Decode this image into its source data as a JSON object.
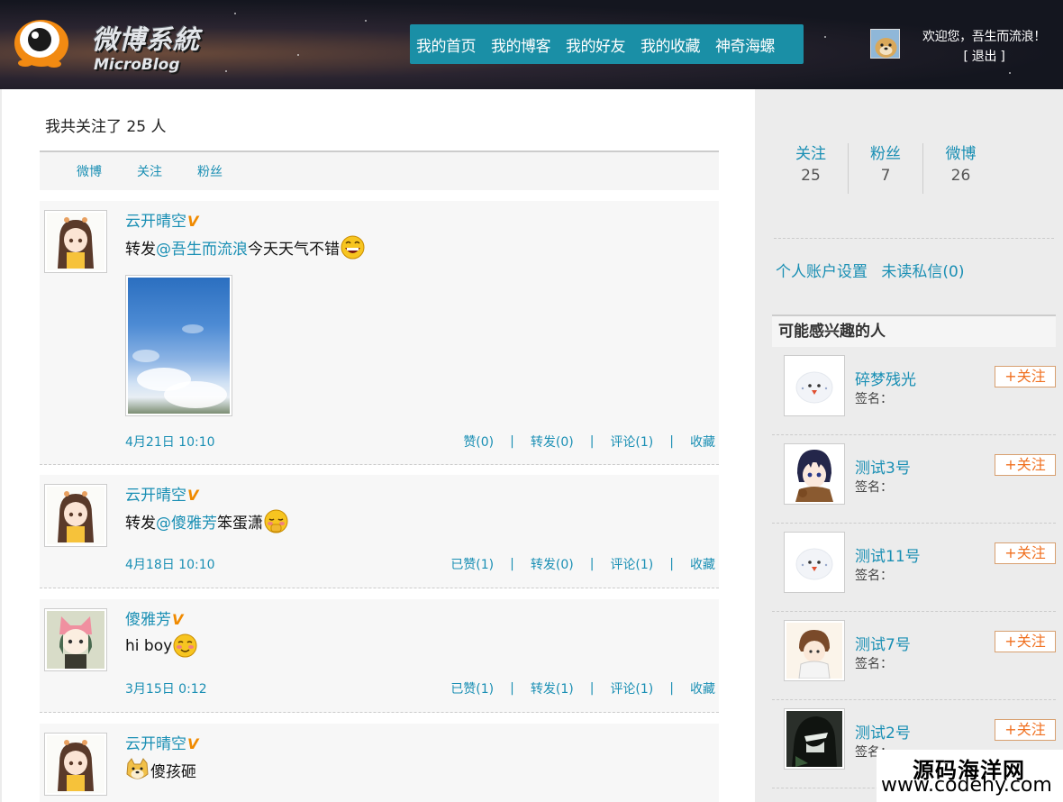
{
  "header": {
    "logo_title": "微博系統",
    "logo_subtitle": "MicroBlog",
    "nav": [
      "我的首页",
      "我的博客",
      "我的好友",
      "我的收藏",
      "神奇海螺"
    ],
    "welcome": "欢迎您，吾生而流浪！",
    "logout": "[ 退出 ]"
  },
  "main": {
    "follow_summary": "我共关注了 25 人",
    "subtabs": [
      "微博",
      "关注",
      "粉丝"
    ],
    "posts": [
      {
        "author": "云开晴空",
        "vip": "V",
        "prefix": "转发",
        "mention": "@吾生而流浪",
        "text": " 今天天气不错",
        "emoji": "grin-emoji",
        "time": "4月21日 10:10",
        "like": "赞(0)",
        "repost": "转发(0)",
        "comment": "评论(1)",
        "fav": "收藏"
      },
      {
        "author": "云开晴空",
        "vip": "V",
        "prefix": "转发",
        "mention": "@傻雅芳",
        "text": " 笨蛋潇",
        "emoji": "shy-emoji",
        "time": "4月18日 10:10",
        "like": "已赞(1)",
        "repost": "转发(0)",
        "comment": "评论(1)",
        "fav": "收藏"
      },
      {
        "author": "傻雅芳",
        "vip": "V",
        "prefix": "",
        "mention": "",
        "text": "hi boy",
        "emoji": "blush-emoji",
        "time": "3月15日 0:12",
        "like": "已赞(1)",
        "repost": "转发(1)",
        "comment": "评论(1)",
        "fav": "收藏"
      },
      {
        "author": "云开晴空",
        "vip": "V",
        "prefix": "",
        "mention": "",
        "text": "傻孩砸",
        "emoji": "doge-emoji"
      }
    ],
    "action_separator": "|"
  },
  "sidebar": {
    "stats": [
      {
        "label": "关注",
        "value": "25"
      },
      {
        "label": "粉丝",
        "value": "7"
      },
      {
        "label": "微博",
        "value": "26"
      }
    ],
    "links": [
      "个人账户设置",
      "未读私信(0)"
    ],
    "suggest_title": "可能感兴趣的人",
    "follow_label": "+关注",
    "signature_label": "签名：",
    "suggestions": [
      {
        "name": "碎梦残光"
      },
      {
        "name": "测试3号"
      },
      {
        "name": "测试11号"
      },
      {
        "name": "测试7号"
      },
      {
        "name": "测试2号"
      }
    ]
  },
  "watermark": {
    "line1": "源码海洋网",
    "line2": "www.codehy.com"
  },
  "colors": {
    "accent": "#1a8fb4",
    "nav_bg": "#1a8fa6",
    "vip": "#f08a00",
    "follow_btn": "#f07020"
  }
}
